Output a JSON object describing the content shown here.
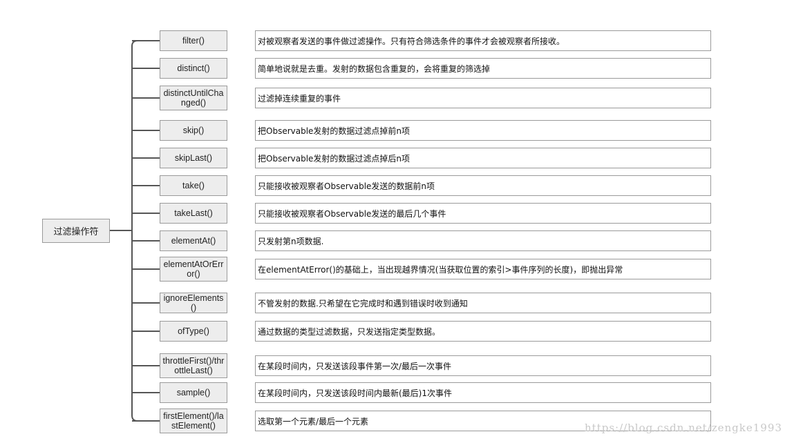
{
  "root": {
    "label": "过滤操作符"
  },
  "items": [
    {
      "method": "filter()",
      "description": "对被观察者发送的事件做过滤操作。只有符合筛选条件的事件才会被观察者所接收。"
    },
    {
      "method": "distinct()",
      "description": "简单地说就是去重。发射的数据包含重复的，会将重复的筛选掉"
    },
    {
      "method": "distinctUntilChanged()",
      "description": "过滤掉连续重复的事件"
    },
    {
      "method": "skip()",
      "description": "把Observable发射的数据过滤点掉前n项"
    },
    {
      "method": "skipLast()",
      "description": "把Observable发射的数据过滤点掉后n项"
    },
    {
      "method": "take()",
      "description": "只能接收被观察者Observable发送的数据前n项"
    },
    {
      "method": "takeLast()",
      "description": "只能接收被观察者Observable发送的最后几个事件"
    },
    {
      "method": "elementAt()",
      "description": "只发射第n项数据."
    },
    {
      "method": "elementAtOrError()",
      "description": "在elementAtError()的基础上，当出现越界情况(当获取位置的索引>事件序列的长度)，即抛出异常"
    },
    {
      "method": "ignoreElements()",
      "description": "不管发射的数据.只希望在它完成时和遇到错误时收到通知"
    },
    {
      "method": "ofType()",
      "description": "通过数据的类型过滤数据，只发送指定类型数据。"
    },
    {
      "method": "throttleFirst()/throttleLast()",
      "description": "在某段时间内，只发送该段事件第一次/最后一次事件"
    },
    {
      "method": "sample()",
      "description": "在某段时间内，只发送该段时间内最新(最后)1次事件"
    },
    {
      "method": "firstElement()/lastElement()",
      "description": "选取第一个元素/最后一个元素"
    }
  ],
  "watermark": "https://blog.csdn.net/zengke1993",
  "colors": {
    "line": "#555555",
    "box_fill": "#ededed",
    "box_border": "#9a9a9a"
  }
}
